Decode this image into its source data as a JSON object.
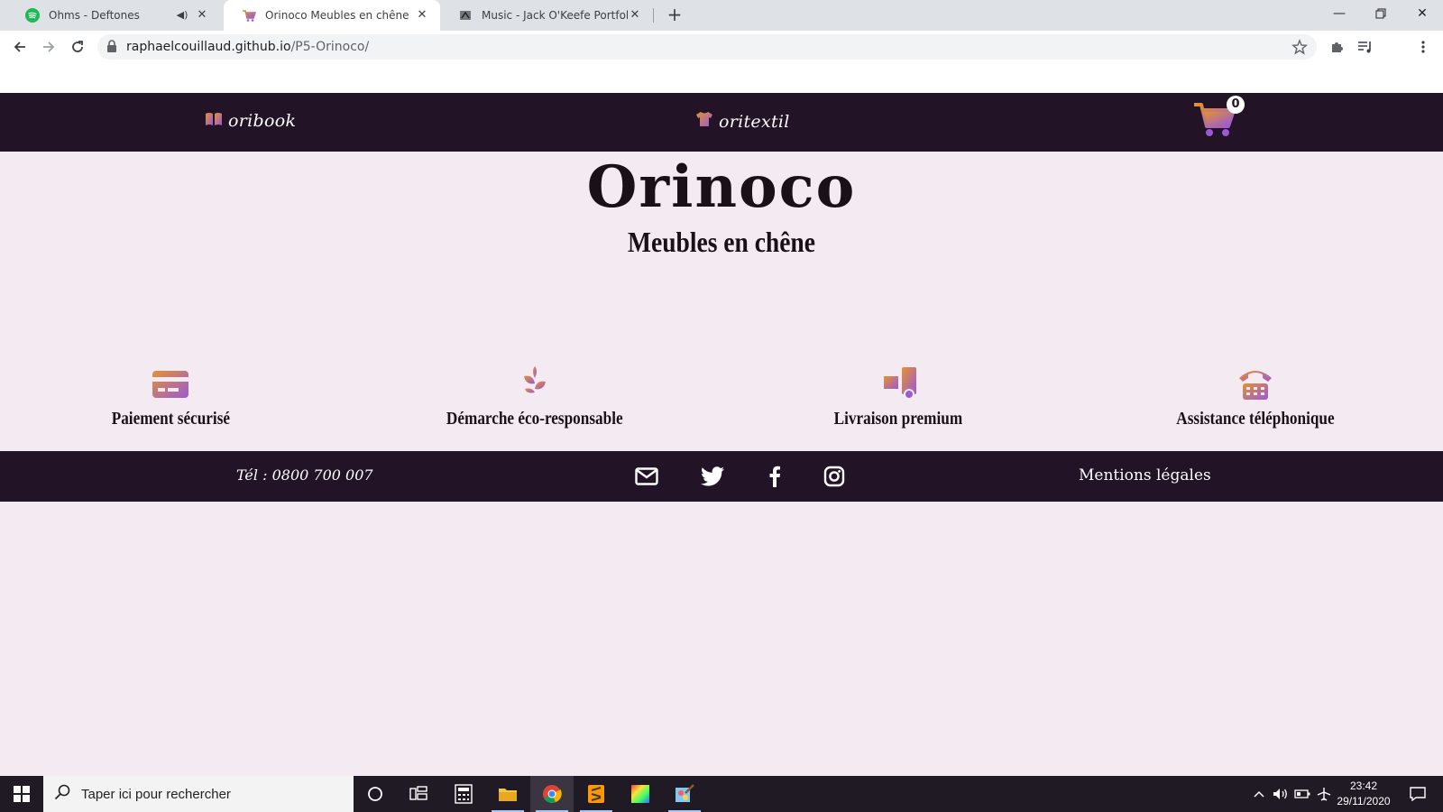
{
  "browser": {
    "tabs": [
      {
        "title": "Ohms - Deftones",
        "active": false,
        "audio": true
      },
      {
        "title": "Orinoco Meubles en chêne",
        "active": true
      },
      {
        "title": "Music - Jack O'Keefe Portfolio",
        "active": false
      }
    ],
    "url": {
      "host": "raphaelcouillaud.github.io",
      "path": "/P5-Orinoco/"
    }
  },
  "site": {
    "nav": {
      "links": [
        {
          "label": "oribook",
          "icon": "book-icon"
        },
        {
          "label": "oritextil",
          "icon": "tshirt-icon"
        }
      ],
      "cart": {
        "count": "0",
        "icon": "cart-icon"
      }
    },
    "hero": {
      "brand": "Orinoco",
      "tagline": "Meubles en chêne"
    },
    "features": [
      {
        "label": "Paiement sécurisé",
        "icon": "credit-card-icon"
      },
      {
        "label": "Démarche éco-responsable",
        "icon": "leaf-icon"
      },
      {
        "label": "Livraison premium",
        "icon": "delivery-truck-icon"
      },
      {
        "label": "Assistance téléphonique",
        "icon": "telephone-icon"
      }
    ],
    "footer": {
      "phone": "Tél : 0800 700 007",
      "legal": "Mentions légales",
      "social": [
        "mail-icon",
        "twitter-icon",
        "facebook-icon",
        "instagram-icon"
      ]
    },
    "colors": {
      "dark": "#221326",
      "background": "#f4eaf2",
      "gradient_start": "#e4922e",
      "gradient_end": "#9b59d6"
    }
  },
  "taskbar": {
    "search_placeholder": "Taper ici pour rechercher",
    "time": "23:42",
    "date": "29/11/2020"
  }
}
